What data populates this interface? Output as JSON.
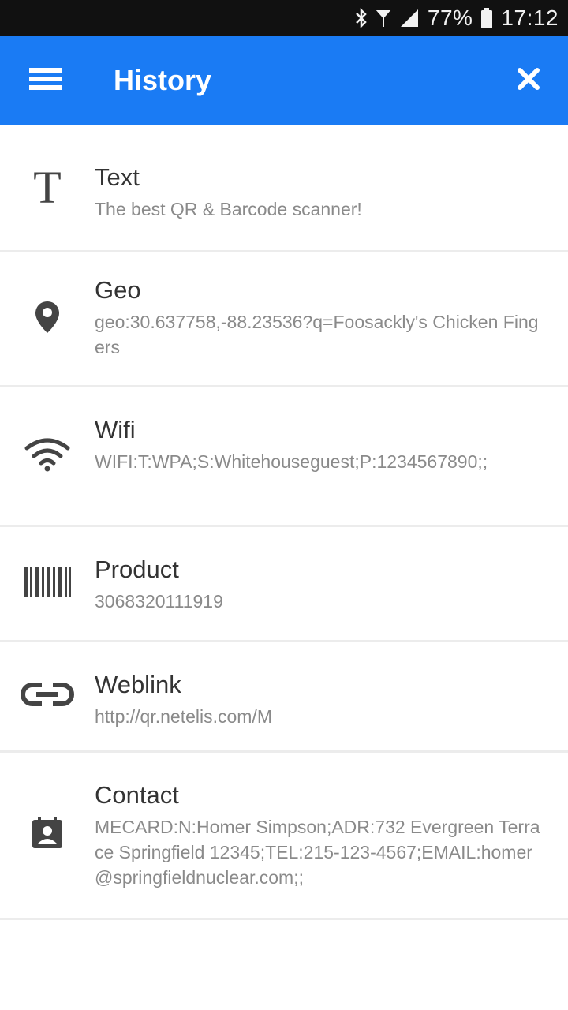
{
  "status_bar": {
    "battery": "77%",
    "time": "17:12"
  },
  "app_bar": {
    "title": "History",
    "menu_icon": "hamburger-menu-icon",
    "close_icon": "close-icon"
  },
  "colors": {
    "app_bar": "#1a7bf4",
    "status_bar": "#111111",
    "title_text": "#333333",
    "sub_text": "#8a8a8a",
    "divider": "#ececec"
  },
  "history": [
    {
      "type": "Text",
      "icon": "text-icon",
      "content": "The best QR & Barcode scanner!"
    },
    {
      "type": "Geo",
      "icon": "location-pin-icon",
      "content": "geo:30.637758,-88.23536?q=Foosackly's Chicken Fingers"
    },
    {
      "type": "Wifi",
      "icon": "wifi-icon",
      "content": "WIFI:T:WPA;S:Whitehouseguest;P:1234567890;;"
    },
    {
      "type": "Product",
      "icon": "barcode-icon",
      "content": "3068320111919"
    },
    {
      "type": "Weblink",
      "icon": "link-icon",
      "content": "http://qr.netelis.com/M"
    },
    {
      "type": "Contact",
      "icon": "contact-card-icon",
      "content": "MECARD:N:Homer Simpson;ADR:732 Evergreen Terrace Springfield 12345;TEL:215-123-4567;EMAIL:homer@springfieldnuclear.com;;"
    }
  ]
}
